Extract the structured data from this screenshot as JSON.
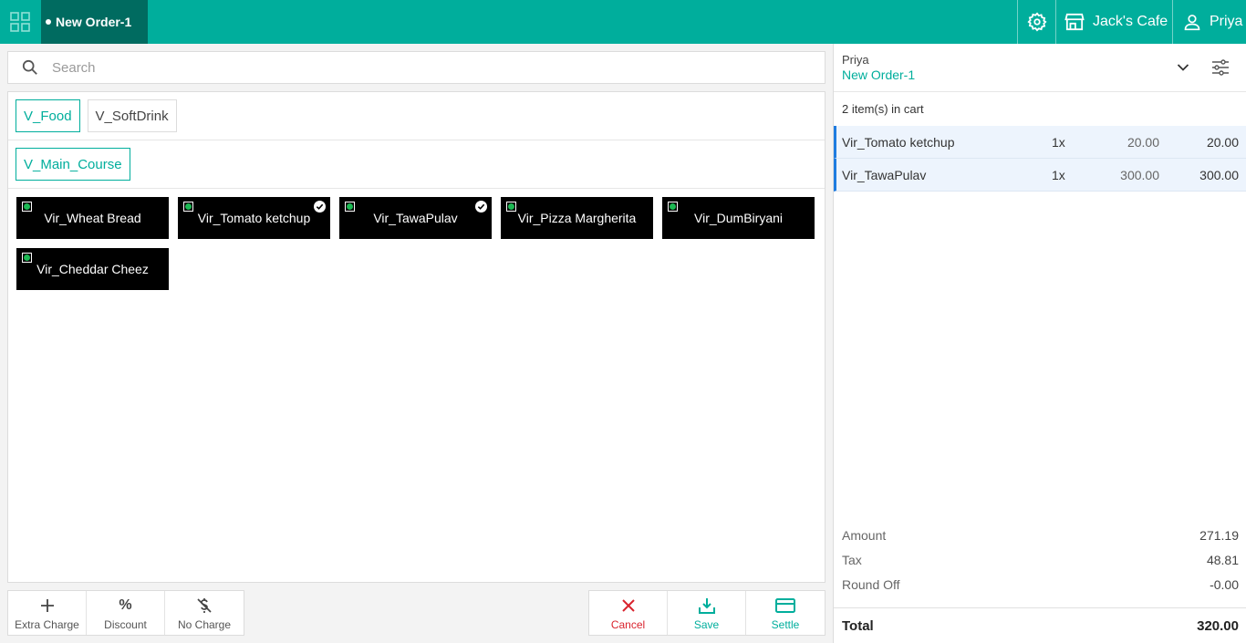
{
  "topbar": {
    "order_tab": "New Order-1",
    "outlet": "Jack's Cafe",
    "user": "Priya"
  },
  "search": {
    "placeholder": "Search",
    "value": ""
  },
  "categories": [
    {
      "label": "V_Food",
      "active": true
    },
    {
      "label": "V_SoftDrink",
      "active": false
    }
  ],
  "subcategories": [
    {
      "label": "V_Main_Course",
      "active": true
    }
  ],
  "items": [
    {
      "label": "Vir_Wheat Bread",
      "in_cart": false
    },
    {
      "label": "Vir_Tomato ketchup",
      "in_cart": true
    },
    {
      "label": "Vir_TawaPulav",
      "in_cart": true
    },
    {
      "label": "Vir_Pizza Margherita",
      "in_cart": false
    },
    {
      "label": "Vir_DumBiryani",
      "in_cart": false
    },
    {
      "label": "Vir_Cheddar Cheez",
      "in_cart": false
    }
  ],
  "actions_left": [
    {
      "label": "Extra Charge",
      "icon": "plus-icon"
    },
    {
      "label": "Discount",
      "icon": "percent-icon"
    },
    {
      "label": "No Charge",
      "icon": "no-dollar-icon"
    }
  ],
  "actions_right": [
    {
      "label": "Cancel",
      "icon": "close-icon"
    },
    {
      "label": "Save",
      "icon": "download-icon"
    },
    {
      "label": "Settle",
      "icon": "card-icon"
    }
  ],
  "cart": {
    "customer": "Priya",
    "order": "New Order-1",
    "count_text": "2 item(s) in cart",
    "lines": [
      {
        "name": "Vir_Tomato ketchup",
        "qty": "1x",
        "price": "20.00",
        "total": "20.00"
      },
      {
        "name": "Vir_TawaPulav",
        "qty": "1x",
        "price": "300.00",
        "total": "300.00"
      }
    ],
    "summary": [
      {
        "label": "Amount",
        "value": "271.19"
      },
      {
        "label": "Tax",
        "value": "48.81"
      },
      {
        "label": "Round Off",
        "value": "-0.00"
      }
    ],
    "total_label": "Total",
    "total_value": "320.00"
  },
  "colors": {
    "brand": "#00ae9c",
    "brand_dark": "#006b60",
    "cancel": "#d9232d",
    "selected_line": "#1f7ce0"
  }
}
